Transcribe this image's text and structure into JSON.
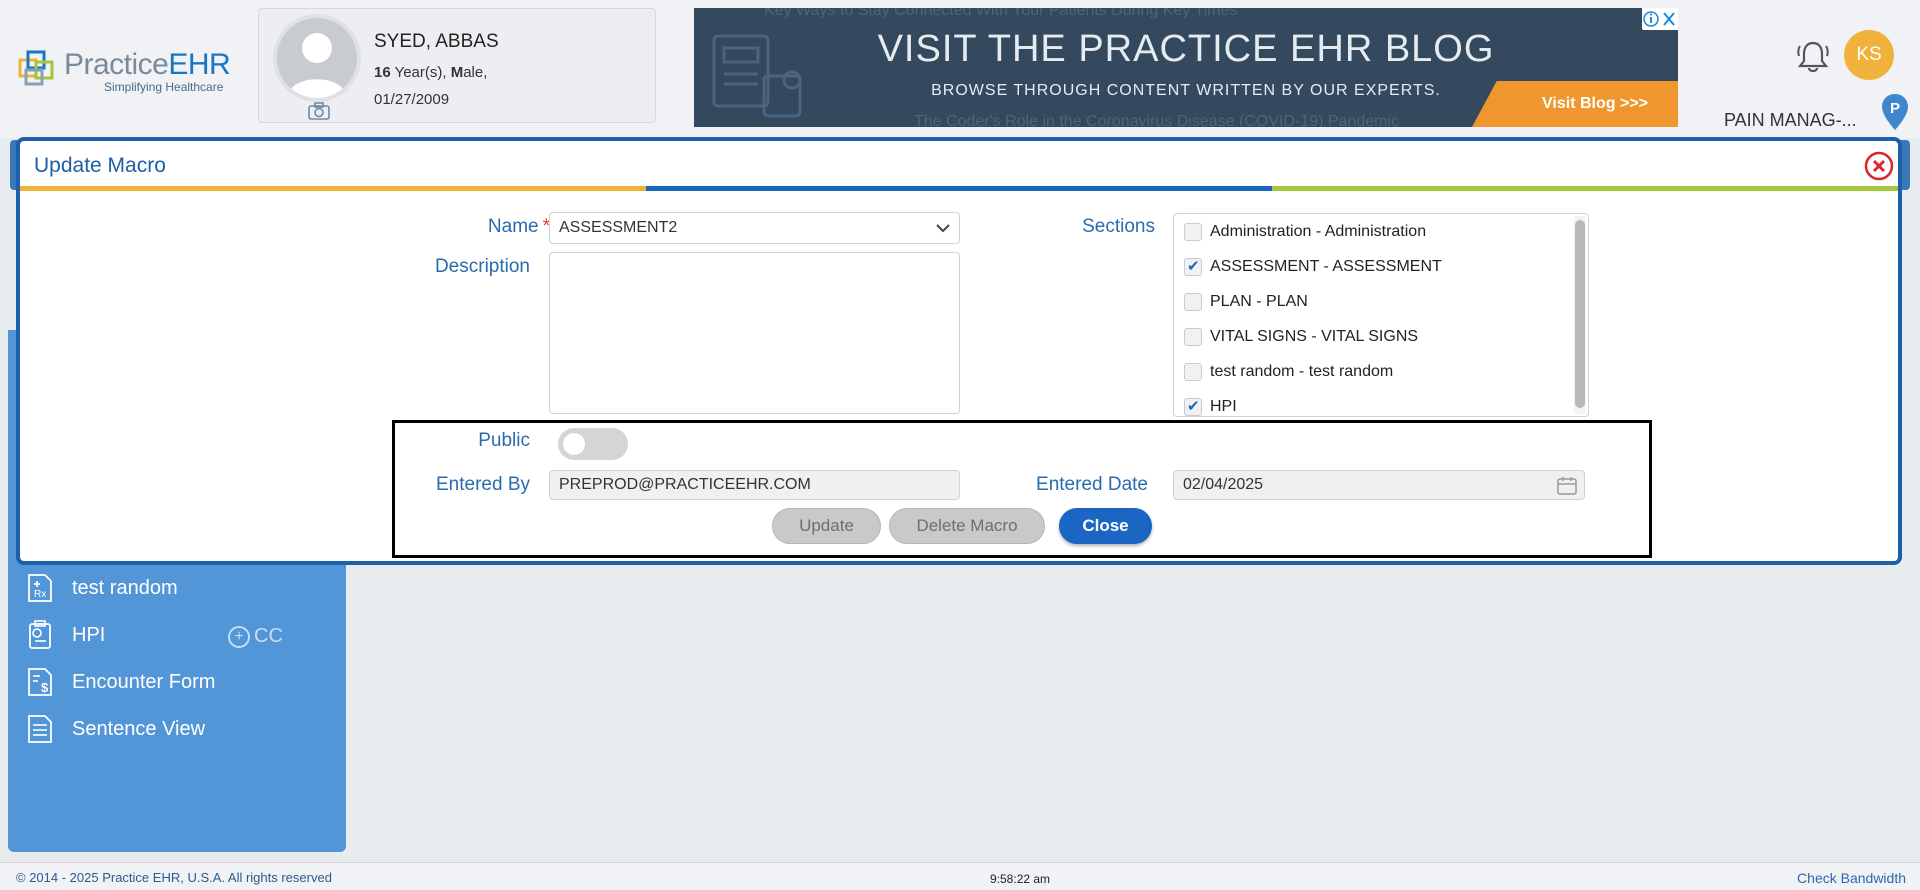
{
  "header": {
    "logo_word_1": "Practice",
    "logo_word_2": "EHR",
    "logo_tagline": "Simplifying Healthcare",
    "patient": {
      "name": "SYED, ABBAS",
      "age_num": "16",
      "age_unit": " Year(s), ",
      "sex_initial": "M",
      "sex_rest": "ale,",
      "dob": "01/27/2009"
    },
    "ad": {
      "bg_text_1": "Key Ways to Stay Connected With Your Patients During Key Times",
      "bg_text_2": "The Coder's Role in the Coronavirus Disease (COVID-19) Pandemic",
      "title": "VISIT THE PRACTICE EHR BLOG",
      "subtitle": "BROWSE THROUGH CONTENT WRITTEN BY OUR EXPERTS.",
      "cta": "Visit Blog >>>"
    },
    "user_initials": "KS",
    "practice_name": "PAIN MANAG-...",
    "location_pin_letter": "P"
  },
  "left_panel": {
    "items": [
      {
        "label": "test random",
        "icon": "rx-document-icon"
      },
      {
        "label": "HPI",
        "icon": "clock-document-icon"
      },
      {
        "label": "Encounter Form",
        "icon": "dollar-document-icon"
      },
      {
        "label": "Sentence View",
        "icon": "document-icon"
      }
    ],
    "cc_label": "CC"
  },
  "modal": {
    "title": "Update Macro",
    "strip_colors": [
      "#f0b23a",
      "#1a66c2",
      "#a5c639"
    ],
    "name_label": "Name",
    "required_mark": "*",
    "name_value": "ASSESSMENT2",
    "description_label": "Description",
    "description_value": "",
    "sections_label": "Sections",
    "sections": [
      {
        "label": "Administration - Administration",
        "checked": false
      },
      {
        "label": "ASSESSMENT - ASSESSMENT",
        "checked": true
      },
      {
        "label": "PLAN - PLAN",
        "checked": false
      },
      {
        "label": "VITAL SIGNS - VITAL SIGNS",
        "checked": false
      },
      {
        "label": "test random - test random",
        "checked": false
      },
      {
        "label": "HPI",
        "checked": true
      }
    ],
    "public_label": "Public",
    "public_on": false,
    "entered_by_label": "Entered By",
    "entered_by_value": "PREPROD@PRACTICEEHR.COM",
    "entered_date_label": "Entered Date",
    "entered_date_value": "02/04/2025",
    "buttons": {
      "update": "Update",
      "delete": "Delete Macro",
      "close": "Close"
    }
  },
  "footer": {
    "copyright": "© 2014 - 2025 Practice EHR, U.S.A. All rights reserved",
    "clock": "9:58:22 am",
    "bandwidth": "Check Bandwidth"
  }
}
